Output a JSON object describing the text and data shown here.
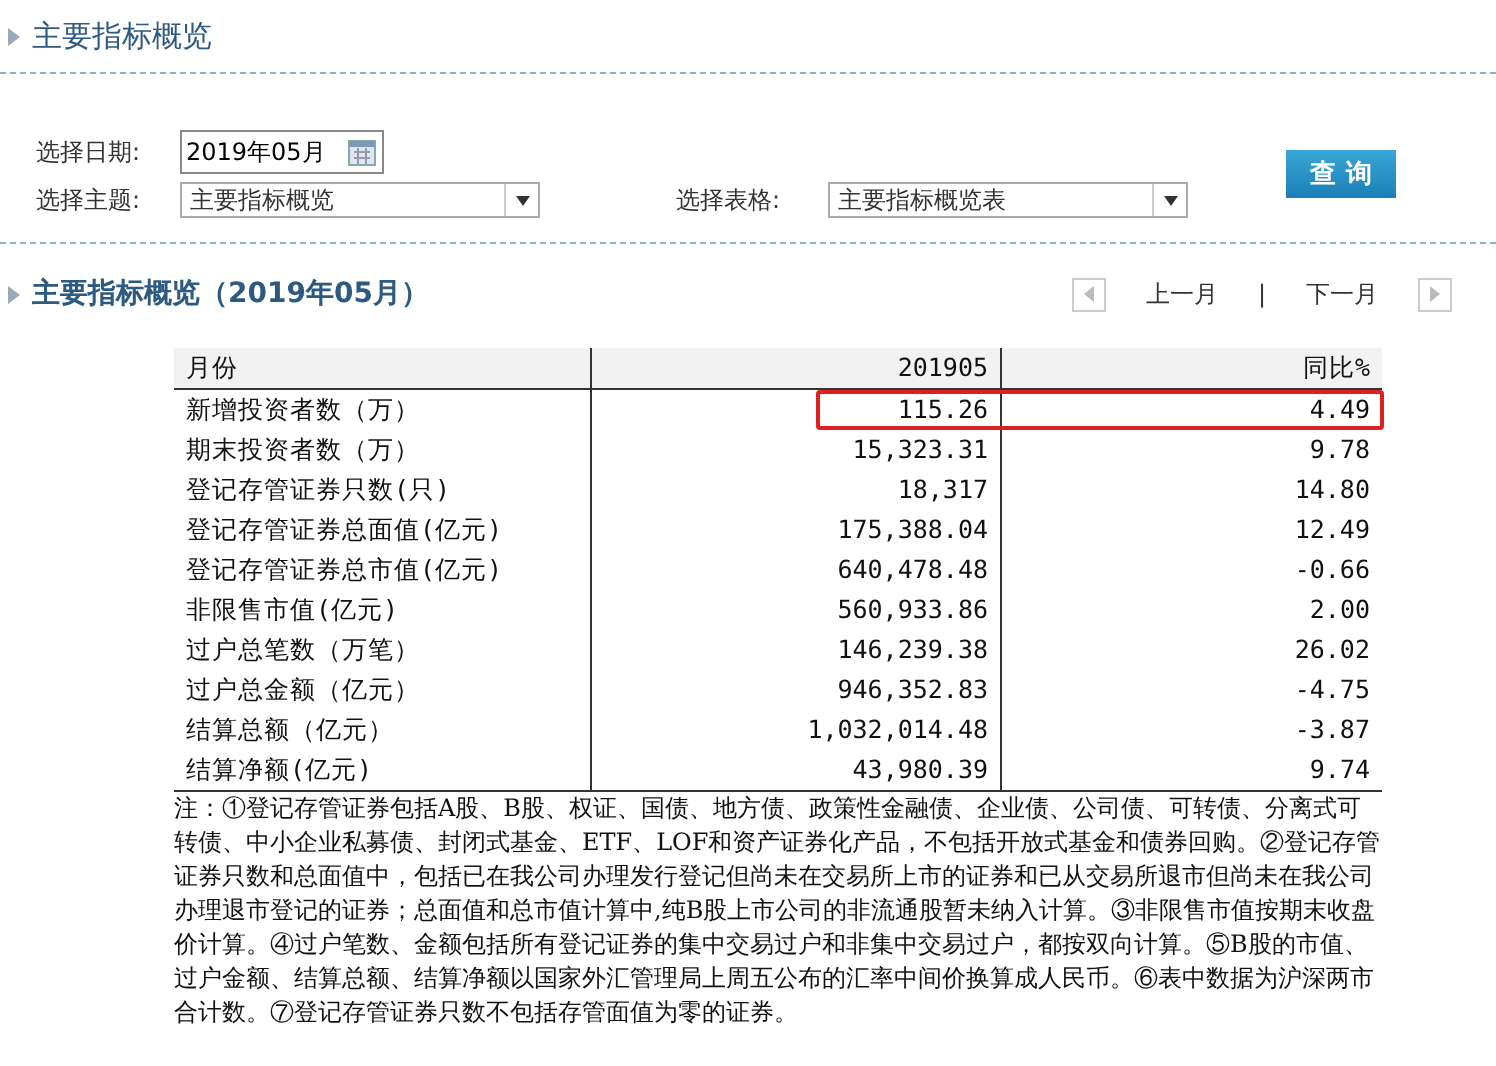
{
  "page_title": "主要指标概览",
  "form": {
    "date_label": "选择日期:",
    "date_value": "2019年05月",
    "topic_label": "选择主题:",
    "topic_value": "主要指标概览",
    "table_label": "选择表格:",
    "table_value": "主要指标概览表",
    "query_button": "查 询"
  },
  "section": {
    "title": "主要指标概览（2019年05月）",
    "prev": "上一月",
    "separator": "|",
    "next": "下一月"
  },
  "table": {
    "columns": [
      "月份",
      "201905",
      "同比%"
    ],
    "rows": [
      {
        "cells": [
          "新增投资者数（万）",
          "115.26",
          "4.49"
        ],
        "highlighted": true
      },
      {
        "cells": [
          "期末投资者数（万）",
          "15,323.31",
          "9.78"
        ],
        "highlighted": false
      },
      {
        "cells": [
          "登记存管证券只数(只)",
          "18,317",
          "14.80"
        ],
        "highlighted": false
      },
      {
        "cells": [
          "登记存管证券总面值(亿元)",
          "175,388.04",
          "12.49"
        ],
        "highlighted": false
      },
      {
        "cells": [
          "登记存管证券总市值(亿元)",
          "640,478.48",
          "-0.66"
        ],
        "highlighted": false
      },
      {
        "cells": [
          "非限售市值(亿元)",
          "560,933.86",
          "2.00"
        ],
        "highlighted": false
      },
      {
        "cells": [
          "过户总笔数（万笔）",
          "146,239.38",
          "26.02"
        ],
        "highlighted": false
      },
      {
        "cells": [
          "过户总金额（亿元）",
          "946,352.83",
          "-4.75"
        ],
        "highlighted": false
      },
      {
        "cells": [
          "结算总额（亿元）",
          "1,032,014.48",
          "-3.87"
        ],
        "highlighted": false
      },
      {
        "cells": [
          "结算净额(亿元)",
          "43,980.39",
          "9.74"
        ],
        "highlighted": false
      }
    ]
  },
  "note": "注：①登记存管证券包括A股、B股、权证、国债、地方债、政策性金融债、企业债、公司债、可转债、分离式可转债、中小企业私募债、封闭式基金、ETF、LOF和资产证券化产品，不包括开放式基金和债券回购。②登记存管证券只数和总面值中，包括已在我公司办理发行登记但尚未在交易所上市的证券和已从交易所退市但尚未在我公司办理退市登记的证券；总面值和总市值计算中,纯B股上市公司的非流通股暂未纳入计算。③非限售市值按期末收盘价计算。④过户笔数、金额包括所有登记证券的集中交易过户和非集中交易过户，都按双向计算。⑤B股的市值、过户金额、结算总额、结算净额以国家外汇管理局上周五公布的汇率中间价换算成人民币。⑥表中数据为沪深两市合计数。⑦登记存管证券只数不包括存管面值为零的证券。"
}
